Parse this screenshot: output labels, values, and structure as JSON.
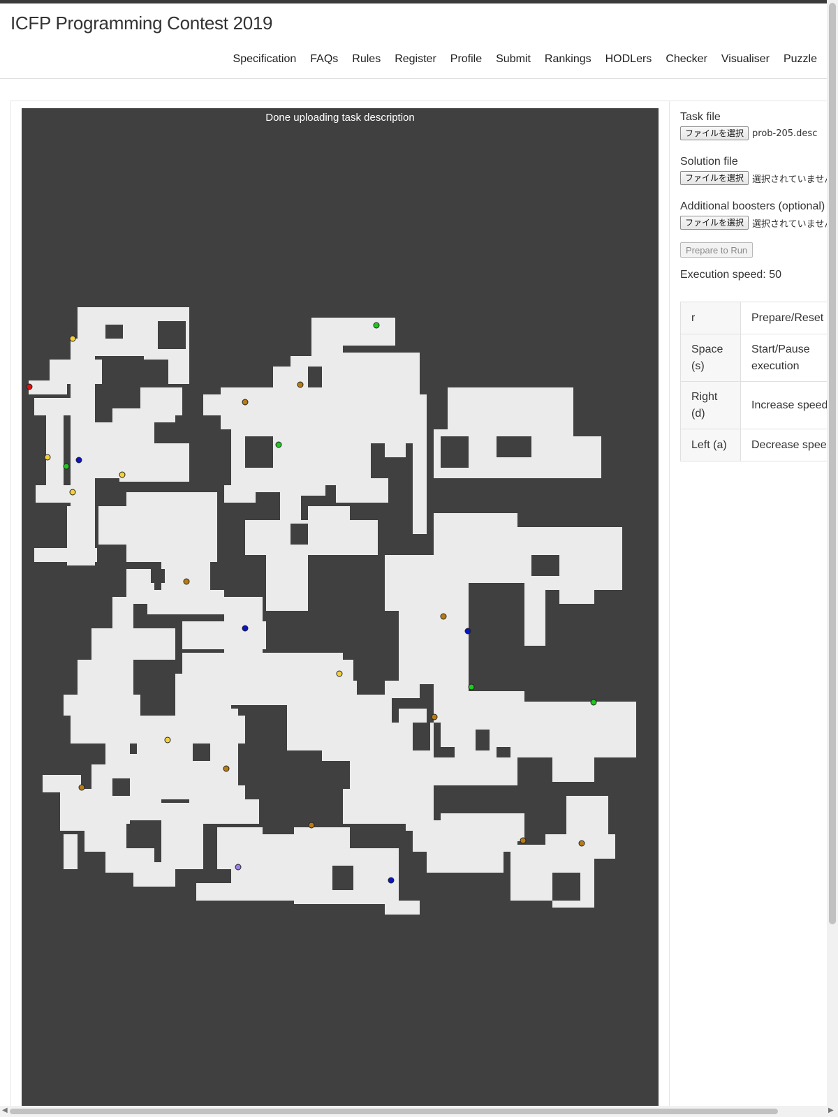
{
  "site": {
    "title": "ICFP Programming Contest 2019"
  },
  "nav": [
    {
      "label": "Specification"
    },
    {
      "label": "FAQs"
    },
    {
      "label": "Rules"
    },
    {
      "label": "Register"
    },
    {
      "label": "Profile"
    },
    {
      "label": "Submit"
    },
    {
      "label": "Rankings"
    },
    {
      "label": "HODLers"
    },
    {
      "label": "Checker"
    },
    {
      "label": "Visualiser"
    },
    {
      "label": "Puzzle"
    }
  ],
  "canvas": {
    "status": "Done uploading task description",
    "background_color": "#404040",
    "free_cell_color": "#ebebeb",
    "booster_colors": {
      "yellow": "#f5d03c",
      "brown": "#b87c15",
      "green": "#1fc81f",
      "blue": "#0a14c8",
      "purple": "#9980e6",
      "red": "#e01010"
    }
  },
  "controls": {
    "task_file": {
      "label": "Task file",
      "button": "ファイルを選択",
      "value": "prob-205.desc"
    },
    "solution_file": {
      "label": "Solution file",
      "button": "ファイルを選択",
      "value": "選択されていません"
    },
    "boosters_file": {
      "label": "Additional boosters (optional)",
      "button": "ファイルを選択",
      "value": "選択されていません"
    },
    "prepare_button": "Prepare to Run",
    "execution_speed": "Execution speed: 50"
  },
  "shortcuts": [
    {
      "key": "r",
      "action": "Prepare/Reset"
    },
    {
      "key": "Space (s)",
      "action": "Start/Pause execution"
    },
    {
      "key": "Right (d)",
      "action": "Increase speed"
    },
    {
      "key": "Left (a)",
      "action": "Decrease speed"
    }
  ]
}
